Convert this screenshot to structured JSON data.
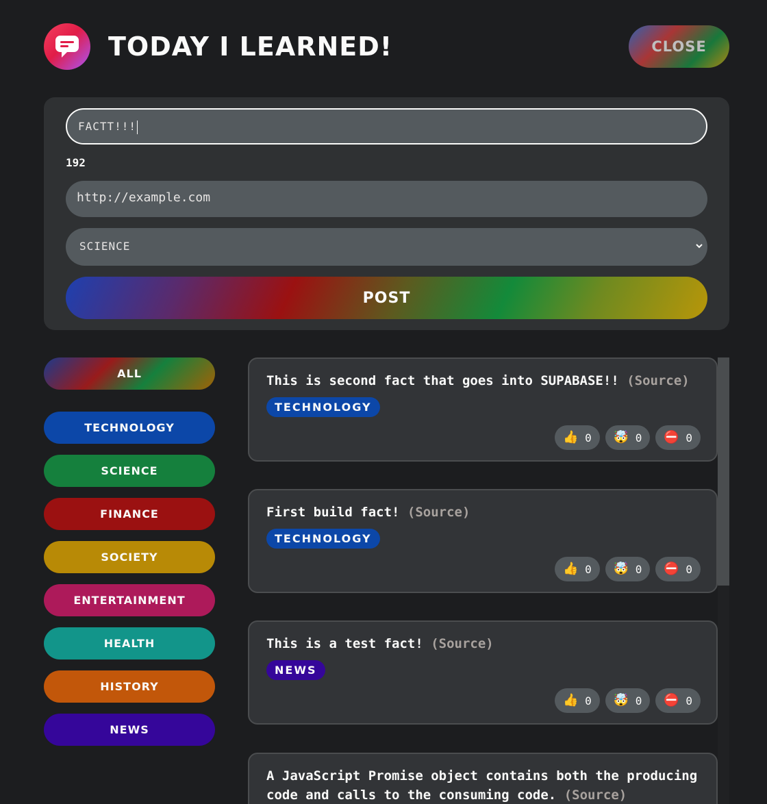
{
  "header": {
    "title": "Today I Learned!",
    "close_label": "Close"
  },
  "form": {
    "fact_value": "FACTT!!!",
    "char_count": "192",
    "source_placeholder": "http://example.com",
    "category_selected": "SCIENCE",
    "post_label": "Post"
  },
  "categories": [
    {
      "label": "All",
      "color": "gradient"
    },
    {
      "label": "technology",
      "color": "#0c47a8"
    },
    {
      "label": "science",
      "color": "#15803d"
    },
    {
      "label": "finance",
      "color": "#9b1111"
    },
    {
      "label": "society",
      "color": "#b88a06"
    },
    {
      "label": "entertainment",
      "color": "#ad1a5a"
    },
    {
      "label": "health",
      "color": "#12958a"
    },
    {
      "label": "history",
      "color": "#c2570a"
    },
    {
      "label": "news",
      "color": "#35069a"
    }
  ],
  "facts": [
    {
      "text": "This is second fact that goes into SUPABASE!!",
      "source": "(Source)",
      "category": "technology",
      "category_color": "#0c47a8",
      "likes": "0",
      "mindblowing": "0",
      "false": "0"
    },
    {
      "text": "First build fact!",
      "source": "(Source)",
      "category": "technology",
      "category_color": "#0c47a8",
      "likes": "0",
      "mindblowing": "0",
      "false": "0"
    },
    {
      "text": "This is a test fact!",
      "source": "(Source)",
      "category": "news",
      "category_color": "#35069a",
      "likes": "0",
      "mindblowing": "0",
      "false": "0"
    },
    {
      "text": "A JavaScript Promise object contains both the producing code and calls to the consuming code.",
      "source": "(Source)"
    }
  ],
  "icons": {
    "like": "thumbs-up-icon",
    "mindblowing": "mind-blown-icon",
    "false": "no-entry-icon"
  }
}
